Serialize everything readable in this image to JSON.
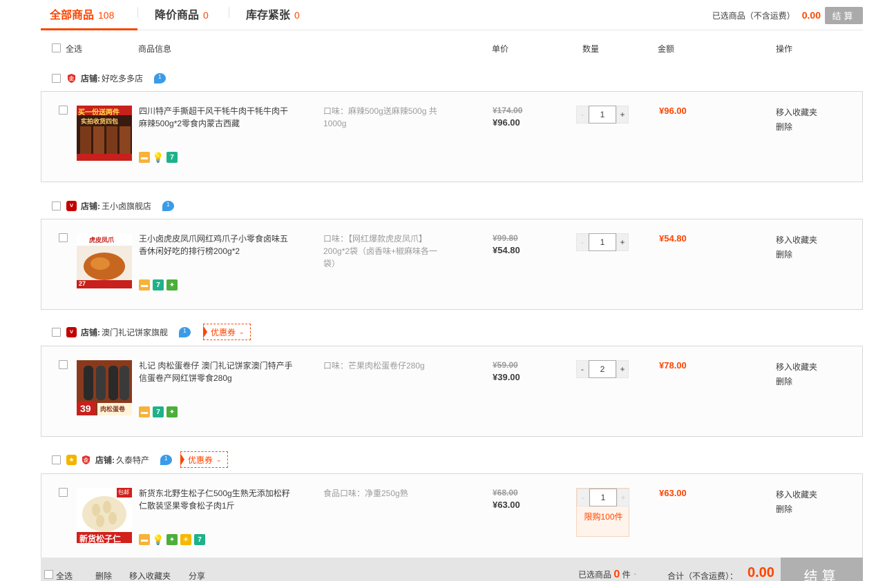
{
  "tabs": [
    {
      "label": "全部商品",
      "count": "108"
    },
    {
      "label": "降价商品",
      "count": "0"
    },
    {
      "label": "库存紧张",
      "count": "0"
    }
  ],
  "summary": {
    "label": "已选商品（不含运费）",
    "amount": "0.00",
    "button": "结算"
  },
  "header": {
    "select_all": "全选",
    "info": "商品信息",
    "price": "单价",
    "qty": "数量",
    "amount": "金额",
    "ops": "操作"
  },
  "shop_label": "店铺:",
  "shops": [
    {
      "name": "好吃多多店",
      "coupon": ""
    },
    {
      "name": "王小卤旗舰店",
      "coupon": ""
    },
    {
      "name": "澳门礼记饼家旗舰",
      "coupon": "优惠券"
    },
    {
      "name": "久泰特产",
      "coupon": "优惠券"
    }
  ],
  "items": [
    {
      "title": "四川特产手撕超干风干牦牛肉干牦牛肉干麻辣500g*2零食内蒙古西藏",
      "spec": "口味：麻辣500g送麻辣500g 共1000g",
      "orig_price": "¥174.00",
      "price": "¥96.00",
      "qty": "1",
      "amount": "¥96.00",
      "thumb_text": "买一份送两件",
      "thumb_sub": "实拍收货四包"
    },
    {
      "title": "王小卤虎皮凤爪网红鸡爪子小零食卤味五香休闲好吃的排行榜200g*2",
      "spec": "口味：【网红爆款虎皮凤爪】200g*2袋（卤香味+椒麻味各一袋）",
      "orig_price": "¥99.80",
      "price": "¥54.80",
      "qty": "1",
      "amount": "¥54.80",
      "thumb_text": "虎皮凤爪",
      "thumb_sub": "27"
    },
    {
      "title": "礼记 肉松蛋卷仔 澳门礼记饼家澳门特产手信蛋卷产网红饼零食280g",
      "spec": "口味：芒果肉松蛋卷仔280g",
      "orig_price": "¥59.00",
      "price": "¥39.00",
      "qty": "2",
      "amount": "¥78.00",
      "thumb_text": "39",
      "thumb_sub": "肉松蛋卷"
    },
    {
      "title": "新货东北野生松子仁500g生熟无添加松籽仁散装坚果零食松子肉1斤",
      "spec": "食品口味：净重250g熟",
      "orig_price": "¥68.00",
      "price": "¥63.00",
      "qty": "1",
      "amount": "¥63.00",
      "limit": "限购100件",
      "thumb_text": "新货松子仁",
      "thumb_sub": "包邮"
    }
  ],
  "ops": {
    "favorite": "移入收藏夹",
    "delete": "删除"
  },
  "footer": {
    "select_all": "全选",
    "delete": "删除",
    "favorite": "移入收藏夹",
    "share": "分享",
    "selected_label": "已选商品",
    "selected_count": "0",
    "unit": "件",
    "total_label": "合计（不含运费）：",
    "total": "0.00",
    "checkout": "结算"
  }
}
